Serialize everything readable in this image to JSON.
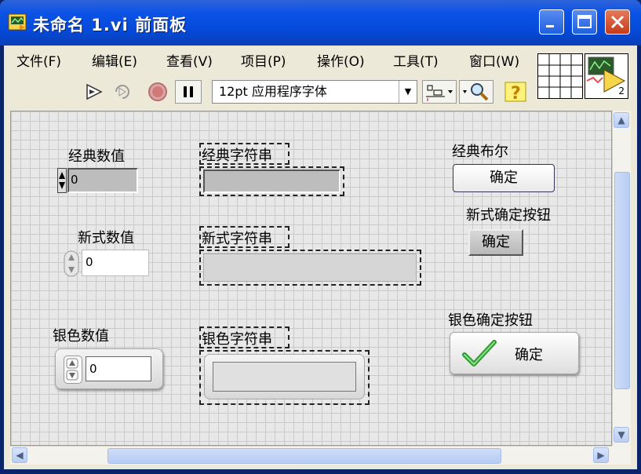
{
  "window": {
    "title": "未命名 1.vi 前面板"
  },
  "menu": [
    {
      "label": "文件(F)"
    },
    {
      "label": "编辑(E)"
    },
    {
      "label": "查看(V)"
    },
    {
      "label": "项目(P)"
    },
    {
      "label": "操作(O)"
    },
    {
      "label": "工具(T)"
    },
    {
      "label": "窗口(W)"
    }
  ],
  "toolbar": {
    "font_select": "12pt 应用程序字体",
    "connector_badge": "2"
  },
  "controls": {
    "classic_numeric": {
      "label": "经典数值",
      "value": "0"
    },
    "classic_string": {
      "label": "经典字符串",
      "value": ""
    },
    "classic_boolean": {
      "label": "经典布尔",
      "button": "确定"
    },
    "modern_ok": {
      "label": "新式确定按钮",
      "button": "确定"
    },
    "modern_numeric": {
      "label": "新式数值",
      "value": "0"
    },
    "modern_string": {
      "label": "新式字符串",
      "value": ""
    },
    "silver_numeric": {
      "label": "银色数值",
      "value": "0"
    },
    "silver_string": {
      "label": "银色字符串",
      "value": ""
    },
    "silver_ok": {
      "label": "银色确定按钮",
      "button": "确定"
    }
  },
  "icons": [
    "labview-vi-icon",
    "minimize-icon",
    "maximize-icon",
    "close-icon",
    "run-icon",
    "run-continuously-icon",
    "abort-icon",
    "pause-icon",
    "align-icon",
    "zoom-icon",
    "help-icon",
    "connector-pane-icon",
    "vi-icon"
  ]
}
